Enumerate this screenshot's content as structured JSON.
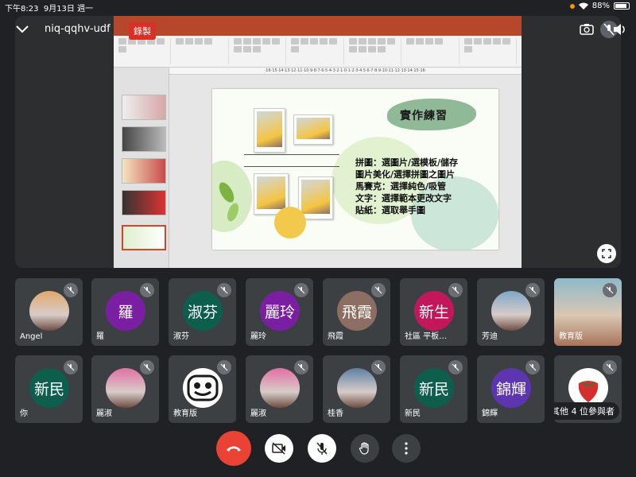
{
  "status_bar": {
    "time": "下午8:23",
    "date": "9月13日 週一",
    "battery": "88%",
    "battery_level": 0.88
  },
  "meeting": {
    "code": "niq-qqhv-udf",
    "recording_label": "錄製"
  },
  "slide": {
    "title": "實作練習",
    "lines": [
      "拼圖：選圖片/選模板/儲存",
      "圖片美化/選擇拼圖之圖片",
      "馬賽克：選擇純色/吸管",
      "文字：選擇範本更改文字",
      "貼紙：選取舉手圖"
    ],
    "ruler_text": "·16·15·14·13·12·11·10·9·8·7·6·5·4·3·2·1·0·1·2·3·4·5·6·7·8·9·10·11·12·13·14·15·16·"
  },
  "participants": [
    {
      "name": "Angel",
      "initials": "",
      "color": "#e0a96d",
      "type": "photo"
    },
    {
      "name": "羅",
      "initials": "羅",
      "color": "#7b1fa2",
      "type": "initials"
    },
    {
      "name": "淑芬",
      "initials": "淑芬",
      "color": "#0d5e4c",
      "type": "initials"
    },
    {
      "name": "麗玲",
      "initials": "麗玲",
      "color": "#7b1fa2",
      "type": "initials"
    },
    {
      "name": "飛霞",
      "initials": "飛霞",
      "color": "#8d6e63",
      "type": "initials"
    },
    {
      "name": "社區 平板…",
      "initials": "新生",
      "color": "#c2185b",
      "type": "initials"
    },
    {
      "name": "芳迪",
      "initials": "",
      "color": "#7fa7c7",
      "type": "photo"
    },
    {
      "name": "教育版",
      "initials": "",
      "color": "#8fb9c9",
      "type": "video"
    },
    {
      "name": "你",
      "initials": "新民",
      "color": "#0d5e4c",
      "type": "initials"
    },
    {
      "name": "麗淑",
      "initials": "",
      "color": "#e36fa5",
      "type": "photo"
    },
    {
      "name": "教育版",
      "initials": "",
      "color": "#ffffff",
      "type": "logo"
    },
    {
      "name": "麗淑",
      "initials": "",
      "color": "#e36fa5",
      "type": "photo"
    },
    {
      "name": "桂香",
      "initials": "",
      "color": "#5d7fa3",
      "type": "photo"
    },
    {
      "name": "新民",
      "initials": "新民",
      "color": "#0d5e4c",
      "type": "initials"
    },
    {
      "name": "錦輝",
      "initials": "錦輝",
      "color": "#5e35b1",
      "type": "initials"
    },
    {
      "name": "",
      "initials": "",
      "color": "#ffffff",
      "type": "strawberry"
    }
  ],
  "others_label": "其他 4 位參與者",
  "controls": {
    "end_call_color": "#ea4335"
  },
  "icons": {
    "back": "chevron-down-icon",
    "camera_switch": "camera-switch-icon",
    "mic_off": "mic-off-icon",
    "speaker": "speaker-icon",
    "fullscreen": "fullscreen-icon",
    "end_call": "end-call-icon",
    "camera_off": "camera-off-icon",
    "raise_hand": "raise-hand-icon",
    "more": "more-vert-icon"
  }
}
